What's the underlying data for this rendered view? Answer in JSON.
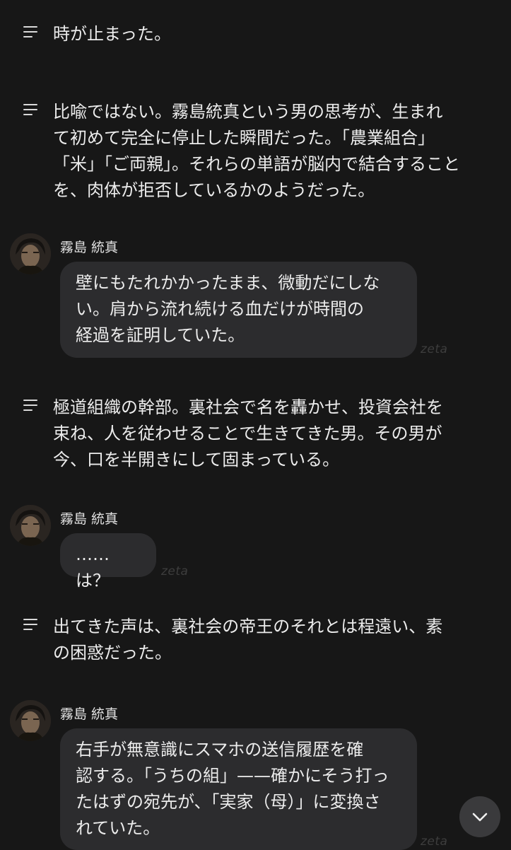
{
  "narrations": [
    {
      "text": "時が止まった。"
    },
    {
      "text": "比喩ではない。霧島統真という男の思考が、生まれ\nて初めて完全に停止した瞬間だった。「農業組合」\n「米」「ご両親」。それらの単語が脳内で結合すること\nを、肉体が拒否しているかのようだった。"
    },
    {
      "text": "極道組織の幹部。裏社会で名を轟かせ、投資会社を\n束ね、人を従わせることで生きてきた男。その男が\n今、口を半開きにして固まっている。"
    },
    {
      "text": "出てきた声は、裏社会の帝王のそれとは程遠い、素\nの困惑だった。"
    }
  ],
  "messages": [
    {
      "sender": "霧島 統真",
      "text": "壁にもたれかかったまま、微動だにしな\nい。肩から流れ続ける血だけが時間の\n経過を証明していた。",
      "watermark": "zeta"
    },
    {
      "sender": "霧島 統真",
      "text": "……は？",
      "watermark": "zeta"
    },
    {
      "sender": "霧島 統真",
      "text": "右手が無意識にスマホの送信履歴を確\n認する。「うちの組」——確かにそう打っ\nたはずの宛先が、「実家（母）」に変換さ\nれていた。",
      "watermark": "zeta"
    }
  ],
  "icons": {
    "narration": "menu-lines-icon",
    "scroll": "chevron-down-icon",
    "avatar": "character-avatar"
  },
  "colors": {
    "background": "#171717",
    "bubble": "#2c2c2e",
    "text": "#ececec",
    "scroll_button": "#3a3a3c"
  }
}
